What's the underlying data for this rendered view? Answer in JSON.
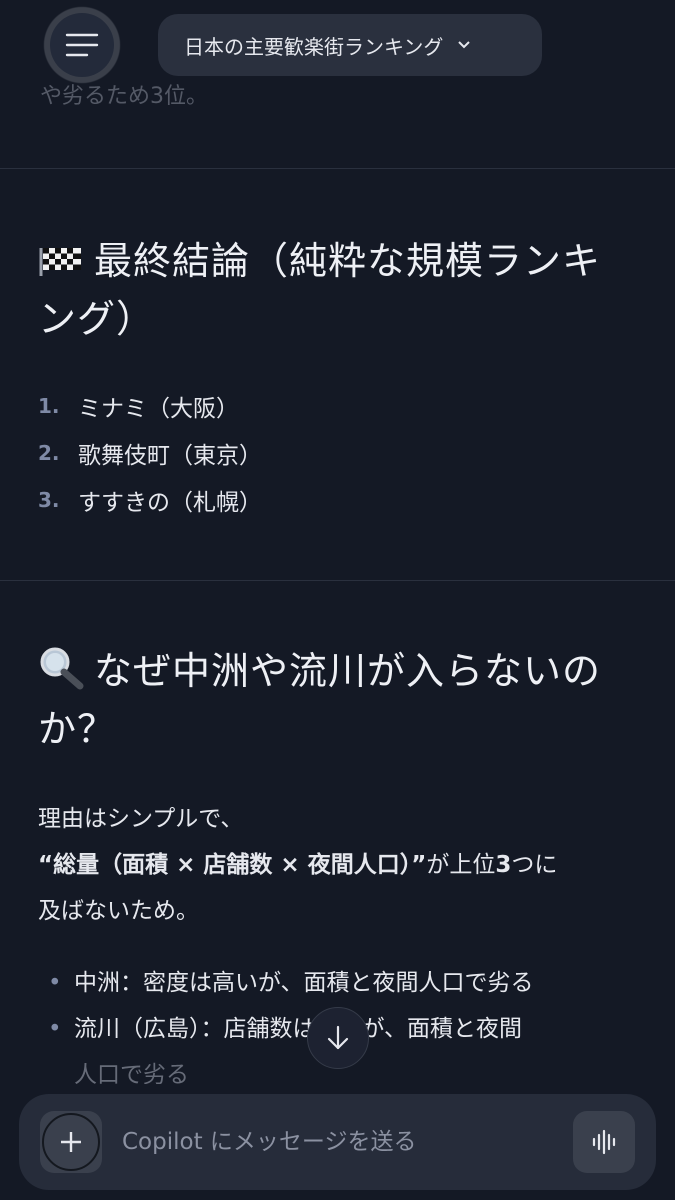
{
  "header": {
    "title": "日本の主要歓楽街ランキング",
    "menu_icon": "hamburger-menu-icon",
    "dropdown_icon": "chevron-down-icon"
  },
  "content": {
    "cut_off_text": "や劣るため3位。",
    "conclusion": {
      "icon": "checkered-flag-icon",
      "title": "最終結論（純粋な規模ランキング）",
      "items": [
        {
          "num": "1.",
          "label": "ミナミ（大阪）"
        },
        {
          "num": "2.",
          "label": "歌舞伎町（東京）"
        },
        {
          "num": "3.",
          "label": "すすきの（札幌）"
        }
      ]
    },
    "why": {
      "icon": "magnifying-glass-icon",
      "title": "なぜ中洲や流川が入らないのか？",
      "para_line1": "理由はシンプルで、",
      "para_line2_bold": "“総量（面積 × 店舗数 × 夜間人口）”",
      "para_line2_rest": "が上位",
      "para_line2_num": "3",
      "para_line2_end": "つに",
      "para_line3": "及ばないため。",
      "bullets": [
        {
          "line1": "中洲：密度は高いが、面積と夜間人口で劣る",
          "line2": ""
        },
        {
          "line1": "流川（広島）：店舗数は多いが、面積と夜間",
          "line2": "人口で劣る"
        }
      ]
    }
  },
  "composer": {
    "placeholder": "Copilot にメッセージを送る",
    "add_icon": "plus-icon",
    "voice_icon": "voice-waveform-icon"
  },
  "scroll_icon": "arrow-down-icon",
  "colors": {
    "background": "#141925",
    "pill": "#2a303e",
    "list_number": "#7f8aa6"
  }
}
